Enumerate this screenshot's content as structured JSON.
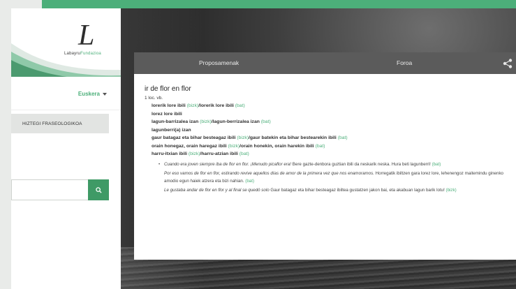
{
  "colors": {
    "brand_green": "#4caf7a",
    "tab_bar": "#5b5b5b",
    "search_button": "#3f9a66"
  },
  "logo": {
    "mark": "L",
    "text_main": "Labayru",
    "text_accent": "Fundazioa"
  },
  "language": {
    "selected": "Euskera"
  },
  "menu": {
    "phraseology": "HIZTEGI FRASEOLOGIKOA"
  },
  "search": {
    "value": "",
    "icon": "search-icon"
  },
  "tabs": {
    "proposals": "Proposamenak",
    "forum": "Foroa",
    "share_icon": "share-icon"
  },
  "entry": {
    "title": "ir de flor en flor",
    "sense": "1 loc. vb.",
    "expressions": [
      {
        "pre": "lorerik lore ibili ",
        "l1": "(bizk)",
        "mid": "/lorerik lore ibili ",
        "l2": "(bat)"
      },
      {
        "pre": "lorez lore ibili",
        "l1": "",
        "mid": "",
        "l2": ""
      },
      {
        "pre": "lagun-barrizalea izan ",
        "l1": "(bizk)",
        "mid": "/lagun-berrizalea izan ",
        "l2": "(bat)"
      },
      {
        "pre": "lagunberri(a) izan",
        "l1": "",
        "mid": "",
        "l2": ""
      },
      {
        "pre": "gaur batagaz eta bihar besteagaz ibili ",
        "l1": "(bizk)",
        "mid": "/gaur batekin eta bihar bestearekin ibili ",
        "l2": "(bat)"
      },
      {
        "pre": "orain honegaz, orain haregaz ibili ",
        "l1": "(bizk)",
        "mid": "/orain honekin, orain harekin ibili ",
        "l2": "(bat)"
      },
      {
        "pre": "harru-itxian ibili ",
        "l1": "(bizk)",
        "mid": "/harru-atzian ibili ",
        "l2": "(bat)"
      }
    ],
    "citations": [
      {
        "es": "Cuando era joven siempre iba de flor en flor. ¡Menudo picaflor era! ",
        "eu": "Bere gazte-denbora guztian ibili da neskarik neska. Hura beti lagunberri! ",
        "tag": "(bat)"
      },
      {
        "es": "Por eso vamos de flor en flor, estirando revive aquellos días de amor de la primera vez que nos enamoramos. ",
        "eu": "Horregatik ibiltzen gara lorez lore, lehenengoz maitemindu ginenko amodio egun haiek atzera eta bizi nahian. ",
        "tag": "(bat)"
      },
      {
        "es": "Le gustaba andar de flor en flor y al final se quedó solo ",
        "eu": "Gaur batagaz eta bihar besteagaz ibiltea gustatzen jakon bai, eta akabuan lagun barik lotu! ",
        "tag": "(bizk)"
      }
    ]
  }
}
